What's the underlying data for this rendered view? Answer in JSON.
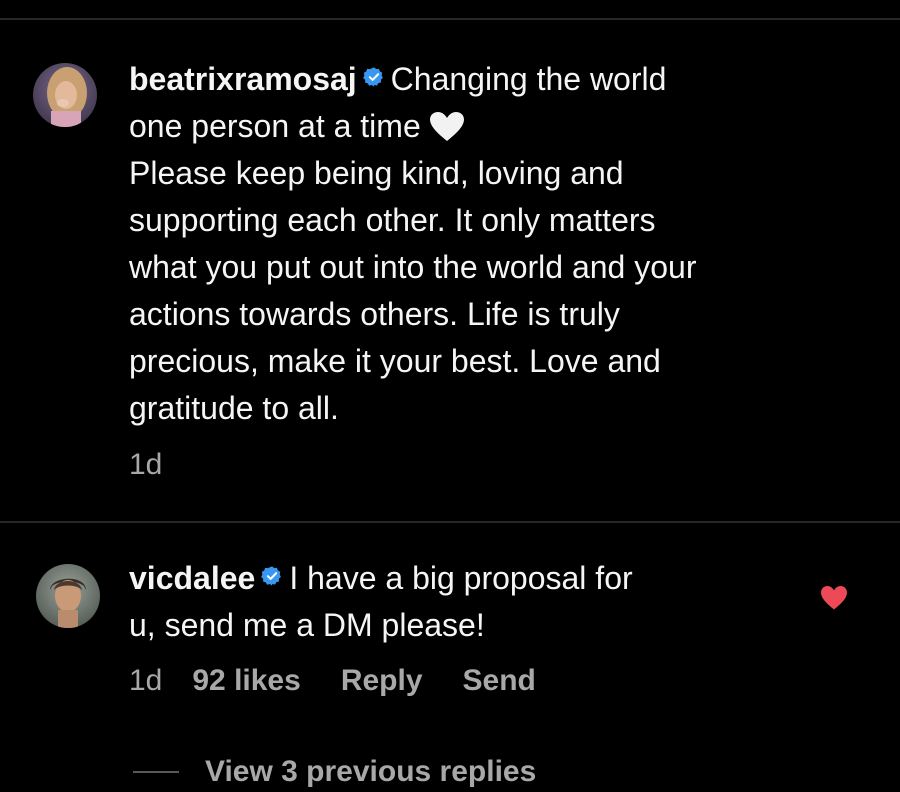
{
  "comments": [
    {
      "username": "beatrixramosaj",
      "verified": true,
      "avatar_icon": "profile-photo-woman",
      "text_lines": [
        "Changing the world",
        "one person at a time",
        "Please keep being kind, loving and",
        "supporting each other. It only matters",
        "what you put out into the world and your",
        "actions towards others. Life is truly",
        "precious, make it your best. Love and",
        "gratitude to all."
      ],
      "emoji": "white-heart-emoji",
      "timestamp": "1d"
    },
    {
      "username": "vicdalee",
      "verified": true,
      "avatar_icon": "profile-photo-man",
      "text_lines": [
        "I have a big proposal for",
        "u, send me a DM please!"
      ],
      "timestamp": "1d",
      "likes": "92 likes",
      "reply_label": "Reply",
      "send_label": "Send",
      "liked": true,
      "like_icon": "heart-filled-icon"
    }
  ],
  "view_replies_label": "View 3 previous replies",
  "colors": {
    "background": "#000000",
    "text": "#f5f5f5",
    "meta_text": "#a8a8a8",
    "verified_badge": "#3897f0",
    "like_heart": "#ed4956",
    "divider": "#262626"
  }
}
